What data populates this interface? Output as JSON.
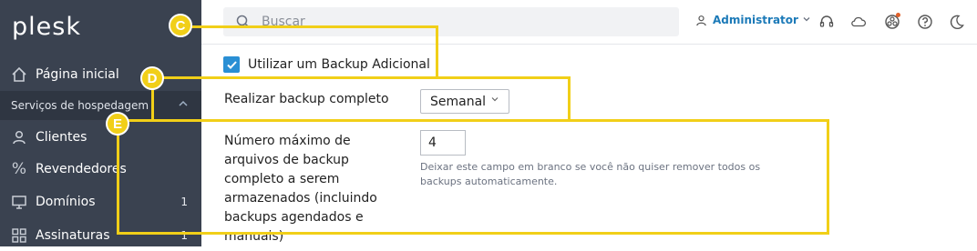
{
  "sidebar": {
    "logo": "plesk",
    "home_label": "Página inicial",
    "section_label": "Serviços de hospedagem",
    "items": [
      {
        "label": "Clientes",
        "icon": "user-icon",
        "count": ""
      },
      {
        "label": "Revendedores",
        "icon": "percent-icon",
        "count": ""
      },
      {
        "label": "Domínios",
        "icon": "monitor-icon",
        "count": "1"
      },
      {
        "label": "Assinaturas",
        "icon": "grid-icon",
        "count": "1"
      }
    ]
  },
  "topbar": {
    "search_placeholder": "Buscar",
    "user_label": "Administrator",
    "icons": [
      "headset-icon",
      "cloud-icon",
      "extensions-icon",
      "help-icon",
      "moon-icon"
    ]
  },
  "form": {
    "additional_backup_label": "Utilizar um Backup Adicional",
    "additional_backup_checked": true,
    "full_backup_label": "Realizar backup completo",
    "full_backup_value": "Semanal",
    "max_files_label": "Número máximo de arquivos de backup completo a serem armazenados (incluindo backups agendados e manuais)",
    "max_files_value": "4",
    "max_files_hint": "Deixar este campo em branco se você não quiser remover todos os backups automaticamente."
  },
  "annotations": {
    "badges": [
      "C",
      "D",
      "E"
    ],
    "color": "#f1cf18"
  }
}
